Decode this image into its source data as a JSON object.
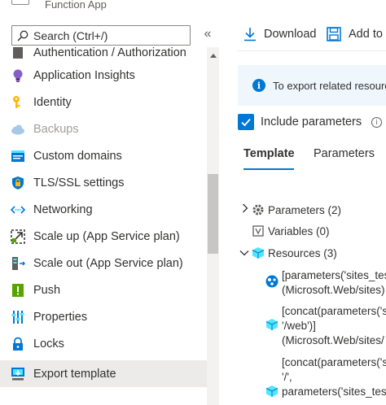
{
  "blade": {
    "subtitle": "Function App"
  },
  "search": {
    "placeholder": "Search (Ctrl+/)"
  },
  "collapse_glyph": "«",
  "menu": {
    "partial_item": "Authentication / Authorization",
    "items": [
      {
        "label": "Application Insights",
        "icon": "lightbulb-icon",
        "state": "normal"
      },
      {
        "label": "Identity",
        "icon": "key-icon",
        "state": "normal"
      },
      {
        "label": "Backups",
        "icon": "cloud-icon",
        "state": "disabled"
      },
      {
        "label": "Custom domains",
        "icon": "domain-icon",
        "state": "normal"
      },
      {
        "label": "TLS/SSL settings",
        "icon": "shield-icon",
        "state": "normal"
      },
      {
        "label": "Networking",
        "icon": "networking-icon",
        "state": "normal"
      },
      {
        "label": "Scale up (App Service plan)",
        "icon": "scale-up-icon",
        "state": "normal"
      },
      {
        "label": "Scale out (App Service plan)",
        "icon": "scale-out-icon",
        "state": "normal"
      },
      {
        "label": "Push",
        "icon": "push-icon",
        "state": "normal"
      },
      {
        "label": "Properties",
        "icon": "properties-icon",
        "state": "normal"
      },
      {
        "label": "Locks",
        "icon": "lock-icon",
        "state": "normal"
      },
      {
        "label": "Export template",
        "icon": "export-template-icon",
        "state": "selected"
      }
    ]
  },
  "toolbar": {
    "download_label": "Download",
    "add_label": "Add to"
  },
  "info": {
    "text": "To export related resources"
  },
  "include_parameters": {
    "label": "Include parameters",
    "checked": true
  },
  "tabs": [
    {
      "label": "Template",
      "active": true
    },
    {
      "label": "Parameters",
      "active": false
    }
  ],
  "tree": {
    "parameters": "Parameters (2)",
    "variables": "Variables (0)",
    "resources": "Resources (3)",
    "resource_items": [
      {
        "lines": [
          "[parameters('sites_test",
          "(Microsoft.Web/sites)"
        ]
      },
      {
        "lines": [
          "[concat(parameters('s",
          "'/web')]",
          "(Microsoft.Web/sites/"
        ]
      },
      {
        "lines": [
          "[concat(parameters('s",
          "'/',",
          "parameters('sites_test"
        ]
      }
    ]
  },
  "colors": {
    "accent": "#0078d4",
    "selected_bg": "#edebe9",
    "info_bg": "#eff6fc"
  }
}
